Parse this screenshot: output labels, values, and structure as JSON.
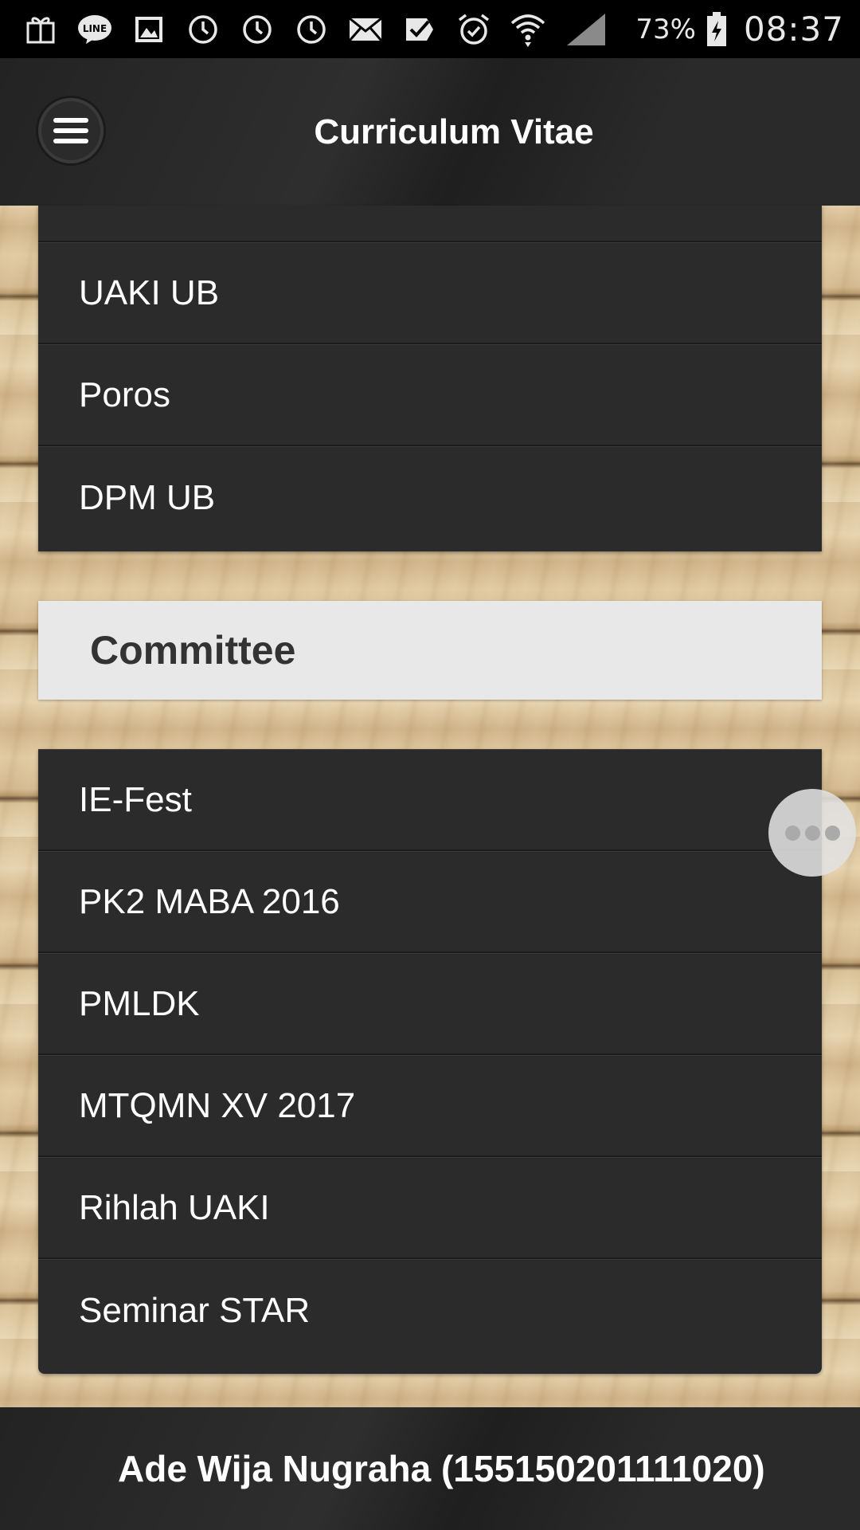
{
  "status_bar": {
    "icons": [
      "gift-icon",
      "line-app-icon",
      "image-icon",
      "alarm-history-icon",
      "alarm-history-icon",
      "alarm-history-icon",
      "mail-icon",
      "task-check-icon",
      "alarm-clock-icon",
      "wifi-icon",
      "signal-icon"
    ],
    "gift_label": "GIFT",
    "line_label": "LINE",
    "battery_percent": "73%",
    "time": "08:37"
  },
  "header": {
    "menu_icon": "hamburger-menu-icon",
    "title": "Curriculum Vitae"
  },
  "organizations": {
    "items": [
      "UAKI UB",
      "Poros",
      "DPM UB"
    ]
  },
  "committee": {
    "heading": "Committee",
    "items": [
      "IE-Fest",
      "PK2 MABA 2016",
      "PMLDK",
      "MTQMN XV 2017",
      "Rihlah UAKI",
      "Seminar STAR"
    ]
  },
  "floating_button": {
    "icon": "more-dots-icon"
  },
  "footer": {
    "text": "Ade Wija Nugraha (155150201111020)"
  },
  "colors": {
    "header_bg": "#232323",
    "list_bg": "#2b2b2b",
    "section_header_bg": "#e8e8e8",
    "text_light": "#ffffff",
    "text_dark": "#333333"
  }
}
